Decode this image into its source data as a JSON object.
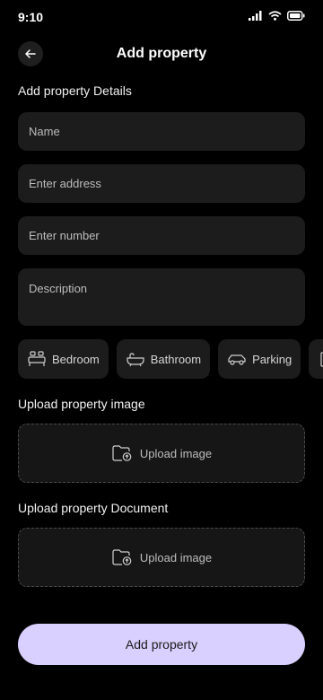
{
  "status_bar": {
    "time": "9:10"
  },
  "header": {
    "title": "Add property"
  },
  "details": {
    "title": "Add property Details",
    "name_placeholder": "Name",
    "address_placeholder": "Enter address",
    "number_placeholder": "Enter number",
    "description_placeholder": "Description"
  },
  "amenities": [
    {
      "label": "Bedroom",
      "icon": "bed-icon"
    },
    {
      "label": "Bathroom",
      "icon": "bathtub-icon"
    },
    {
      "label": "Parking",
      "icon": "car-icon"
    },
    {
      "label": "",
      "icon": "building-icon"
    }
  ],
  "upload_image": {
    "title": "Upload property image",
    "label": "Upload image"
  },
  "upload_document": {
    "title": "Upload property Document",
    "label": "Upload image"
  },
  "submit": {
    "label": "Add property"
  },
  "colors": {
    "background": "#000000",
    "surface": "#1c1c1c",
    "accent": "#d9d0ff"
  }
}
